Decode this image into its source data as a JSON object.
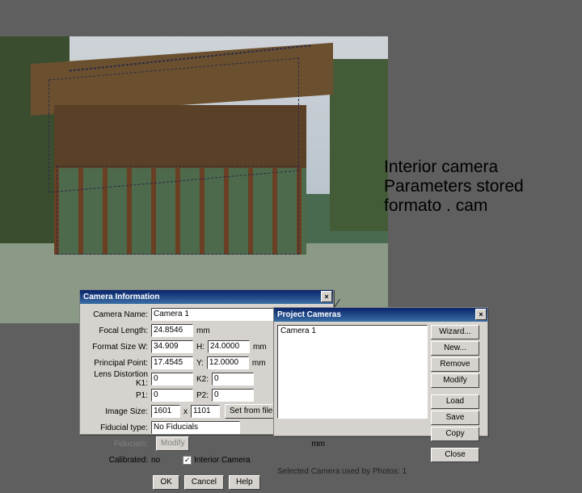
{
  "annotation": {
    "line1": "Interior camera",
    "line2": "Parameters stored",
    "line3": "formato . cam"
  },
  "camera_dialog": {
    "title": "Camera Information",
    "labels": {
      "camera_name": "Camera Name:",
      "focal_length": "Focal Length:",
      "format_size": "Format Size W:",
      "h": "H:",
      "principal_point": "Principal Point:",
      "pp_y": "Y:",
      "lens_distortion": "Lens Distortion K1:",
      "k2": "K2:",
      "p1": "P1:",
      "p2": "P2:",
      "image_size": "Image Size:",
      "by": "x",
      "fiducial_type": "Fiducial type:",
      "fiducials": "Fiducials:",
      "calibrated": "Calibrated:",
      "interior_camera": "Interior Camera"
    },
    "values": {
      "camera_name": "Camera 1",
      "focal_length": "24.8546",
      "format_w": "34.909",
      "format_h": "24.0000",
      "pp_x": "17.4545",
      "pp_y": "12.0000",
      "k1": "0",
      "k2": "0",
      "p1": "0",
      "p2": "0",
      "image_w": "1601",
      "image_h": "1101",
      "fiducial_type": "No Fiducials",
      "calibrated": "no",
      "interior_checked": true
    },
    "units": {
      "mm": "mm"
    },
    "buttons": {
      "set_from_file": "Set from file",
      "modify": "Modify",
      "ok": "OK",
      "cancel": "Cancel",
      "help": "Help"
    }
  },
  "project_dialog": {
    "title": "Project Cameras",
    "list_items": [
      "Camera 1"
    ],
    "buttons": {
      "wizard": "Wizard...",
      "new": "New...",
      "remove": "Remove",
      "modify": "Modify",
      "load": "Load",
      "save": "Save",
      "copy": "Copy",
      "close": "Close"
    },
    "status": "Selected Camera used by Photos: 1"
  }
}
